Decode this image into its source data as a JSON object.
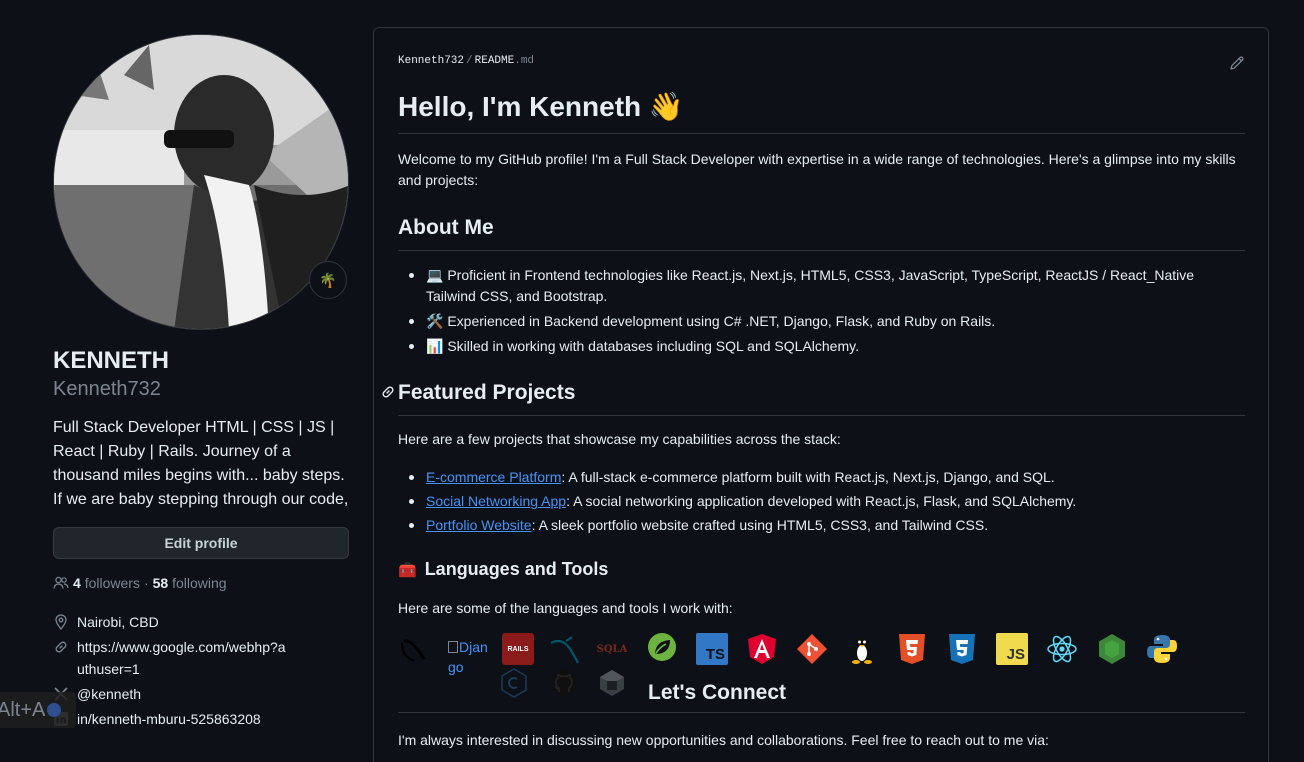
{
  "profile": {
    "fullname": "KENNETH",
    "username": "Kenneth732",
    "bio": "Full Stack Developer HTML | CSS | JS | React | Ruby | Rails. Journey of a thousand miles begins with... baby steps. If we are baby stepping through our code,",
    "edit_label": "Edit profile",
    "followers_count": "4",
    "followers_label": "followers",
    "following_count": "58",
    "following_label": "following",
    "location": "Nairobi, CBD",
    "website": "https://www.google.com/webhp?authuser=1",
    "twitter": "@kenneth",
    "linkedin": "in/kenneth-mburu-525863208",
    "status_emoji": "🌴"
  },
  "overlay": {
    "shortcut": "Alt+A"
  },
  "readme": {
    "owner": "Kenneth732",
    "separator": "/",
    "file_name": "README",
    "file_ext": ".md",
    "title": "Hello, I'm Kenneth 👋",
    "intro": "Welcome to my GitHub profile! I'm a Full Stack Developer with expertise in a wide range of technologies. Here's a glimpse into my skills and projects:",
    "about_heading": "About Me",
    "about_items": [
      "💻 Proficient in Frontend technologies like React.js, Next.js, HTML5, CSS3, JavaScript, TypeScript, ReactJS / React_Native Tailwind CSS, and Bootstrap.",
      "🛠️ Experienced in Backend development using C# .NET, Django, Flask, and Ruby on Rails.",
      "📊 Skilled in working with databases including SQL and SQLAlchemy."
    ],
    "projects_heading": "Featured Projects",
    "projects_intro": "Here are a few projects that showcase my capabilities across the stack:",
    "projects": [
      {
        "name": "E-commerce Platform",
        "desc": ": A full-stack e-commerce platform built with React.js, Next.js, Django, and SQL."
      },
      {
        "name": "Social Networking App",
        "desc": ": A social networking application developed with React.js, Flask, and SQLAlchemy."
      },
      {
        "name": "Portfolio Website",
        "desc": ": A sleek portfolio website crafted using HTML5, CSS3, and Tailwind CSS."
      }
    ],
    "tools_emoji": "🧰",
    "tools_heading": "Languages and Tools",
    "tools_intro": "Here are some of the languages and tools I work with:",
    "django_alt": "Django",
    "icon_labels": {
      "rails": "RAILS",
      "sqla": "SQLA",
      "ts": "TS",
      "js": "JS"
    },
    "tool_icons": [
      "nextjs-icon",
      "django-icon",
      "rails-icon",
      "mysql-icon",
      "sqlalchemy-icon",
      "spring-icon",
      "typescript-icon",
      "angular-icon",
      "git-icon",
      "linux-icon",
      "html5-icon",
      "css3-icon",
      "javascript-icon",
      "react-icon",
      "nodejs-icon",
      "python-icon",
      "csharp-icon",
      "github-icon",
      "terminal-icon"
    ],
    "connect_heading": "Let's Connect",
    "connect_intro": "I'm always interested in discussing new opportunities and collaborations. Feel free to reach out to me via:"
  },
  "colors": {
    "background": "#0d1117",
    "border": "#30363d",
    "link": "#4493f8",
    "muted": "#7d8590",
    "text": "#e6edf3"
  }
}
